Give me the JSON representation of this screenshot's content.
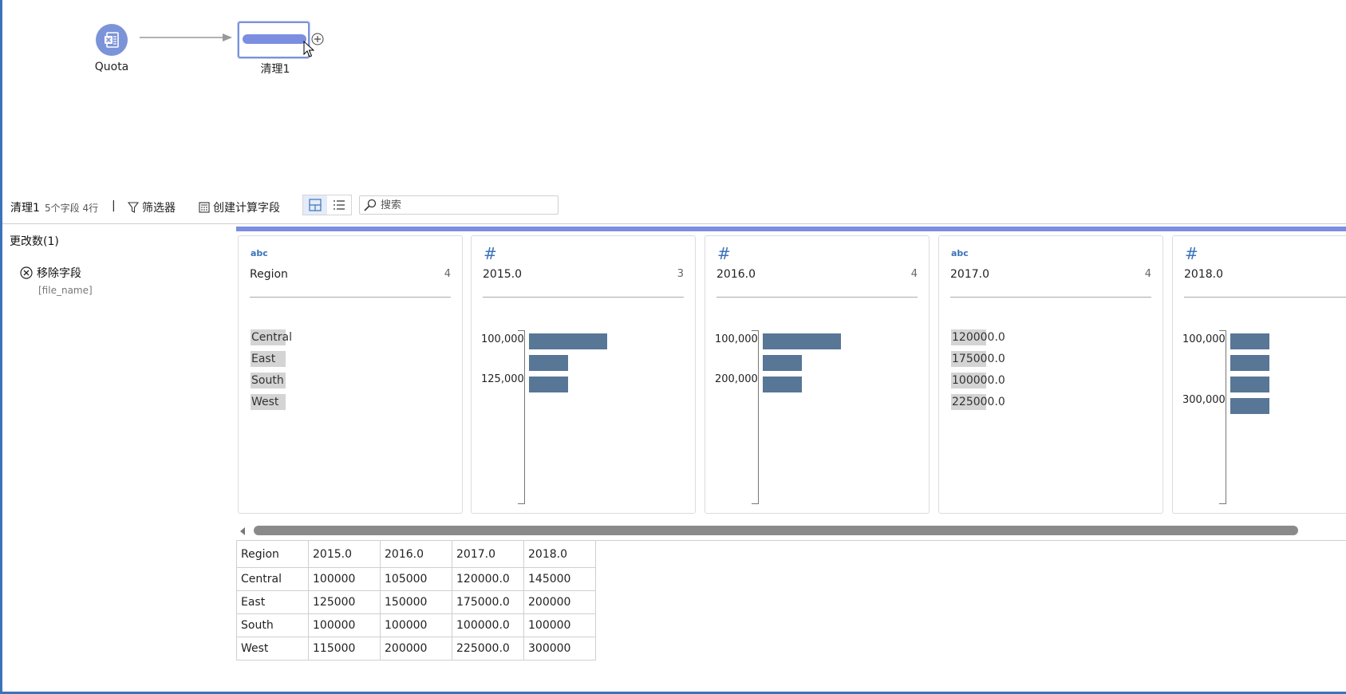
{
  "flow": {
    "input_node": {
      "label": "Quota",
      "icon": "excel-icon",
      "color": "#7b93d8"
    },
    "clean_node": {
      "label": "清理1",
      "color": "#7b8ee0"
    }
  },
  "toolbar": {
    "step_name": "清理1",
    "meta": "5个字段 4行",
    "separator": "|",
    "filter_label": "筛选器",
    "calc_label": "创建计算字段",
    "search_placeholder": "搜索",
    "view_modes": [
      "profile-view",
      "list-view"
    ],
    "active_view": "profile-view"
  },
  "changes": {
    "title": "更改数(1)",
    "items": [
      {
        "action": "移除字段",
        "field": "[file_name]"
      }
    ]
  },
  "profile": {
    "cards": [
      {
        "type_label": "abc",
        "name": "Region",
        "count": "4",
        "values": [
          "Central",
          "East",
          "South",
          "West"
        ]
      },
      {
        "type_label": "#",
        "name": "2015.0",
        "count": "3",
        "ticks": [
          "100,000",
          "125,000"
        ]
      },
      {
        "type_label": "#",
        "name": "2016.0",
        "count": "4",
        "ticks": [
          "100,000",
          "200,000"
        ]
      },
      {
        "type_label": "abc",
        "name": "2017.0",
        "count": "4",
        "values": [
          "120000.0",
          "175000.0",
          "100000.0",
          "225000.0"
        ]
      },
      {
        "type_label": "#",
        "name": "2018.0",
        "count": "",
        "ticks": [
          "100,000",
          "300,000"
        ]
      }
    ],
    "bar_color": "#587696"
  },
  "grid": {
    "headers": [
      "Region",
      "2015.0",
      "2016.0",
      "2017.0",
      "2018.0"
    ],
    "rows": [
      [
        "Central",
        "100000",
        "105000",
        "120000.0",
        "145000"
      ],
      [
        "East",
        "125000",
        "150000",
        "175000.0",
        "200000"
      ],
      [
        "South",
        "100000",
        "100000",
        "100000.0",
        "100000"
      ],
      [
        "West",
        "115000",
        "200000",
        "225000.0",
        "300000"
      ]
    ]
  }
}
